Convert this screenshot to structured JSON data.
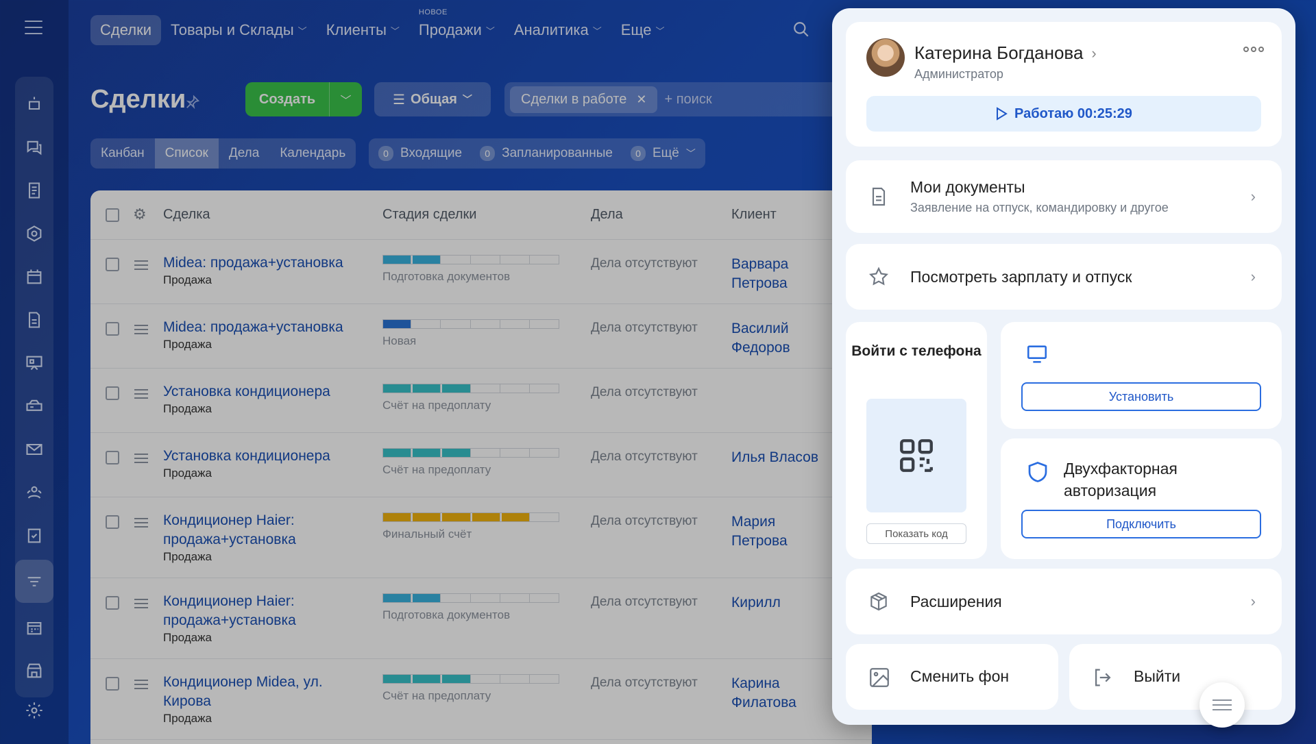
{
  "topnav": {
    "items": [
      {
        "label": "Сделки",
        "active": true,
        "has_chevron": false
      },
      {
        "label": "Товары и Склады",
        "active": false,
        "has_chevron": true
      },
      {
        "label": "Клиенты",
        "active": false,
        "has_chevron": true
      },
      {
        "label": "Продажи",
        "active": false,
        "has_chevron": true,
        "badge": "НОВОЕ"
      },
      {
        "label": "Аналитика",
        "active": false,
        "has_chevron": true
      },
      {
        "label": "Еще",
        "active": false,
        "has_chevron": true
      }
    ]
  },
  "header": {
    "title": "Сделки",
    "create_label": "Создать",
    "filter_label": "Общая",
    "filter_chip": "Сделки в работе",
    "search_placeholder": "+ поиск"
  },
  "view_tabs": [
    "Канбан",
    "Список",
    "Дела",
    "Календарь"
  ],
  "active_view_tab": "Список",
  "counters": [
    {
      "count": "0",
      "label": "Входящие"
    },
    {
      "count": "0",
      "label": "Запланированные"
    },
    {
      "count": "0",
      "label": "Ещё"
    }
  ],
  "table": {
    "columns": [
      "Сделка",
      "Стадия сделки",
      "Дела",
      "Клиент"
    ],
    "rows": [
      {
        "title": "Midea: продажа+установка",
        "type": "Продажа",
        "stage": "Подготовка документов",
        "progress": 0.33,
        "color": "#3ab3e0",
        "activity": "Дела отсутствуют",
        "client": "Варвара Петрова"
      },
      {
        "title": "Midea: продажа+установка",
        "type": "Продажа",
        "stage": "Новая",
        "progress": 0.17,
        "color": "#2a74d6",
        "activity": "Дела отсутствуют",
        "client": "Василий Федоров"
      },
      {
        "title": "Установка кондиционера",
        "type": "Продажа",
        "stage": "Счёт на предоплату",
        "progress": 0.5,
        "color": "#38c2c9",
        "activity": "Дела отсутствуют",
        "client": ""
      },
      {
        "title": "Установка кондиционера",
        "type": "Продажа",
        "stage": "Счёт на предоплату",
        "progress": 0.5,
        "color": "#38c2c9",
        "activity": "Дела отсутствуют",
        "client": "Илья Власов"
      },
      {
        "title": "Кондиционер Haier: продажа+установка",
        "type": "Продажа",
        "stage": "Финальный счёт",
        "progress": 0.83,
        "color": "#f2b30f",
        "activity": "Дела отсутствуют",
        "client": "Мария Петрова"
      },
      {
        "title": "Кондиционер Haier: продажа+установка",
        "type": "Продажа",
        "stage": "Подготовка документов",
        "progress": 0.33,
        "color": "#3ab3e0",
        "activity": "Дела отсутствуют",
        "client": "Кирилл"
      },
      {
        "title": "Кондиционер Midea, ул. Кирова",
        "type": "Продажа",
        "stage": "Счёт на предоплату",
        "progress": 0.5,
        "color": "#38c2c9",
        "activity": "Дела отсутствуют",
        "client": "Карина Филатова"
      }
    ]
  },
  "popup": {
    "user_name": "Катерина Богданова",
    "user_role": "Администратор",
    "working_label": "Работаю 00:25:29",
    "docs_title": "Мои документы",
    "docs_sub": "Заявление на отпуск, командировку и другое",
    "salary_title": "Посмотреть зарплату и отпуск",
    "phone_title": "Войти с телефона",
    "show_code": "Показать код",
    "install_label": "Установить",
    "twofa_title": "Двухфакторная авторизация",
    "twofa_button": "Подключить",
    "extensions_title": "Расширения",
    "change_bg": "Сменить фон",
    "logout": "Выйти"
  },
  "colors": {
    "accent": "#1f57c8",
    "create_green": "#3bc44b",
    "link_blue": "#1a4fb4"
  },
  "sidebar_icons": [
    "robot-icon",
    "chat-icon",
    "document-icon",
    "hexagon-icon",
    "calendar-icon",
    "file-icon",
    "board-icon",
    "drive-icon",
    "mail-icon",
    "contacts-icon",
    "tasks-icon",
    "crm-funnel-icon",
    "schedule-icon",
    "store-icon",
    "settings-icon"
  ]
}
